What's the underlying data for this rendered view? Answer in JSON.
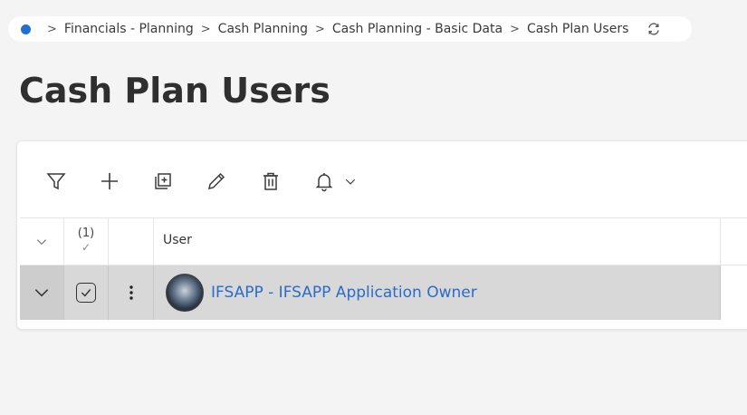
{
  "breadcrumb": {
    "items": [
      "Financials - Planning",
      "Cash Planning",
      "Cash Planning - Basic Data",
      "Cash Plan Users"
    ],
    "separator": ">",
    "refresh_icon": "refresh-icon",
    "accent": "#1f6fd6"
  },
  "page": {
    "title": "Cash Plan Users"
  },
  "toolbar": {
    "buttons": [
      "filter-icon",
      "plus-icon",
      "duplicate-icon",
      "pencil-icon",
      "trash-icon",
      "bell-icon"
    ],
    "bell_dropdown_icon": "chevron-down-icon"
  },
  "table": {
    "selected_count": "(1)",
    "selected_check": "✓",
    "columns": [
      "User"
    ],
    "rows": [
      {
        "user": "IFSAPP - IFSAPP Application Owner",
        "selected": true,
        "expanded": false
      }
    ]
  },
  "colors": {
    "link": "#2a6cc7",
    "row_selected_bg": "#d8d8d8",
    "page_bg": "#f4f4f4"
  }
}
